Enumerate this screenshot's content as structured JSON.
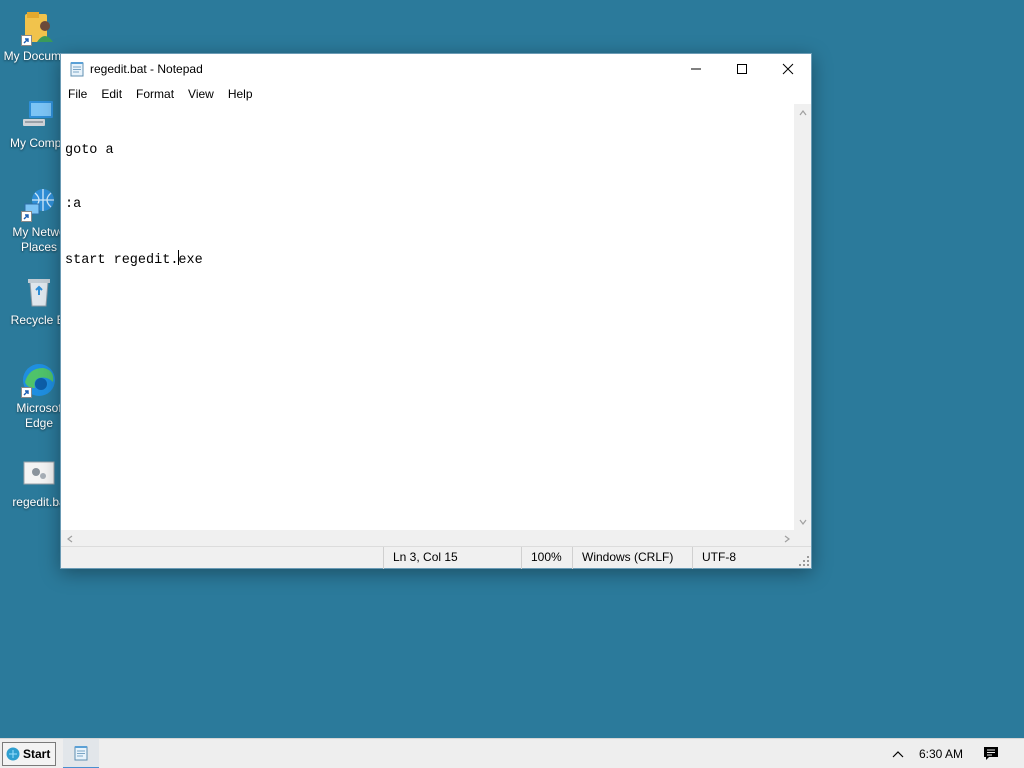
{
  "desktop": {
    "icons": [
      {
        "label": "My Documen",
        "icon": "folder-user-icon"
      },
      {
        "label": "My Compu",
        "icon": "computer-icon"
      },
      {
        "label": "My Netwo\nPlaces",
        "icon": "network-places-icon"
      },
      {
        "label": "Recycle Bi",
        "icon": "recycle-bin-icon"
      },
      {
        "label": "Microsof\nEdge",
        "icon": "edge-icon"
      },
      {
        "label": "regedit.ba",
        "icon": "batch-file-icon"
      }
    ]
  },
  "window": {
    "title": "regedit.bat - Notepad",
    "menu": [
      "File",
      "Edit",
      "Format",
      "View",
      "Help"
    ],
    "editor": {
      "lines": [
        "goto a",
        ":a",
        "start regedit.exe"
      ],
      "caret_line": 3,
      "caret_col": 15
    },
    "status": {
      "position": "Ln 3, Col 15",
      "zoom": "100%",
      "line_endings": "Windows (CRLF)",
      "encoding": "UTF-8"
    }
  },
  "taskbar": {
    "start_label": "Start",
    "clock": "6:30 AM"
  },
  "colors": {
    "desktop_background": "#2b7a9b",
    "taskbar_background": "#eeeeee"
  }
}
